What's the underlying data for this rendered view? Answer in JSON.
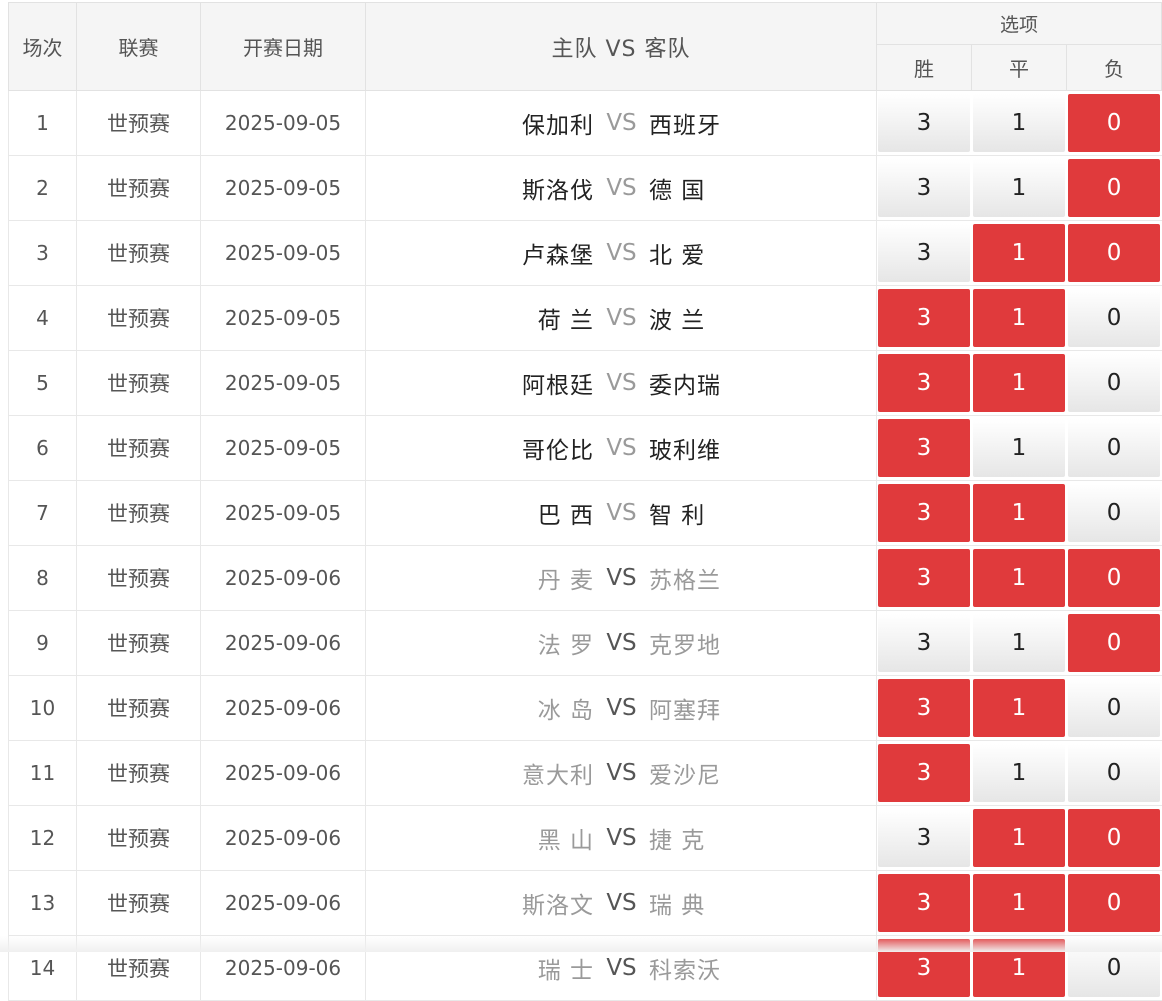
{
  "header": {
    "no": "场次",
    "league": "联赛",
    "date": "开赛日期",
    "match": "主队 VS 客队",
    "options": "选项",
    "win": "胜",
    "draw": "平",
    "lose": "负"
  },
  "colors": {
    "selected": "#e03a3c",
    "header_bg": "#f5f5f5"
  },
  "rows": [
    {
      "no": "1",
      "league": "世预赛",
      "date": "2025-09-05",
      "home": "保加利",
      "vs": "VS",
      "away": "西班牙",
      "win": "3",
      "draw": "1",
      "lose": "0",
      "status": "done",
      "sel": [
        false,
        false,
        true
      ]
    },
    {
      "no": "2",
      "league": "世预赛",
      "date": "2025-09-05",
      "home": "斯洛伐",
      "vs": "VS",
      "away": "德 国",
      "win": "3",
      "draw": "1",
      "lose": "0",
      "status": "done",
      "sel": [
        false,
        false,
        true
      ]
    },
    {
      "no": "3",
      "league": "世预赛",
      "date": "2025-09-05",
      "home": "卢森堡",
      "vs": "VS",
      "away": "北 爱",
      "win": "3",
      "draw": "1",
      "lose": "0",
      "status": "done",
      "sel": [
        false,
        true,
        true
      ]
    },
    {
      "no": "4",
      "league": "世预赛",
      "date": "2025-09-05",
      "home": "荷 兰",
      "vs": "VS",
      "away": "波 兰",
      "win": "3",
      "draw": "1",
      "lose": "0",
      "status": "done",
      "sel": [
        true,
        true,
        false
      ]
    },
    {
      "no": "5",
      "league": "世预赛",
      "date": "2025-09-05",
      "home": "阿根廷",
      "vs": "VS",
      "away": "委内瑞",
      "win": "3",
      "draw": "1",
      "lose": "0",
      "status": "done",
      "sel": [
        true,
        true,
        false
      ]
    },
    {
      "no": "6",
      "league": "世预赛",
      "date": "2025-09-05",
      "home": "哥伦比",
      "vs": "VS",
      "away": "玻利维",
      "win": "3",
      "draw": "1",
      "lose": "0",
      "status": "done",
      "sel": [
        true,
        false,
        false
      ]
    },
    {
      "no": "7",
      "league": "世预赛",
      "date": "2025-09-05",
      "home": "巴 西",
      "vs": "VS",
      "away": "智 利",
      "win": "3",
      "draw": "1",
      "lose": "0",
      "status": "done",
      "sel": [
        true,
        true,
        false
      ]
    },
    {
      "no": "8",
      "league": "世预赛",
      "date": "2025-09-06",
      "home": "丹 麦",
      "vs": "VS",
      "away": "苏格兰",
      "win": "3",
      "draw": "1",
      "lose": "0",
      "status": "pending",
      "sel": [
        true,
        true,
        true
      ]
    },
    {
      "no": "9",
      "league": "世预赛",
      "date": "2025-09-06",
      "home": "法 罗",
      "vs": "VS",
      "away": "克罗地",
      "win": "3",
      "draw": "1",
      "lose": "0",
      "status": "pending",
      "sel": [
        false,
        false,
        true
      ]
    },
    {
      "no": "10",
      "league": "世预赛",
      "date": "2025-09-06",
      "home": "冰 岛",
      "vs": "VS",
      "away": "阿塞拜",
      "win": "3",
      "draw": "1",
      "lose": "0",
      "status": "pending",
      "sel": [
        true,
        true,
        false
      ]
    },
    {
      "no": "11",
      "league": "世预赛",
      "date": "2025-09-06",
      "home": "意大利",
      "vs": "VS",
      "away": "爱沙尼",
      "win": "3",
      "draw": "1",
      "lose": "0",
      "status": "pending",
      "sel": [
        true,
        false,
        false
      ]
    },
    {
      "no": "12",
      "league": "世预赛",
      "date": "2025-09-06",
      "home": "黑 山",
      "vs": "VS",
      "away": "捷 克",
      "win": "3",
      "draw": "1",
      "lose": "0",
      "status": "pending",
      "sel": [
        false,
        true,
        true
      ]
    },
    {
      "no": "13",
      "league": "世预赛",
      "date": "2025-09-06",
      "home": "斯洛文",
      "vs": "VS",
      "away": "瑞 典",
      "win": "3",
      "draw": "1",
      "lose": "0",
      "status": "pending",
      "sel": [
        true,
        true,
        true
      ]
    },
    {
      "no": "14",
      "league": "世预赛",
      "date": "2025-09-06",
      "home": "瑞 士",
      "vs": "VS",
      "away": "科索沃",
      "win": "3",
      "draw": "1",
      "lose": "0",
      "status": "pending",
      "sel": [
        true,
        true,
        false
      ]
    }
  ]
}
